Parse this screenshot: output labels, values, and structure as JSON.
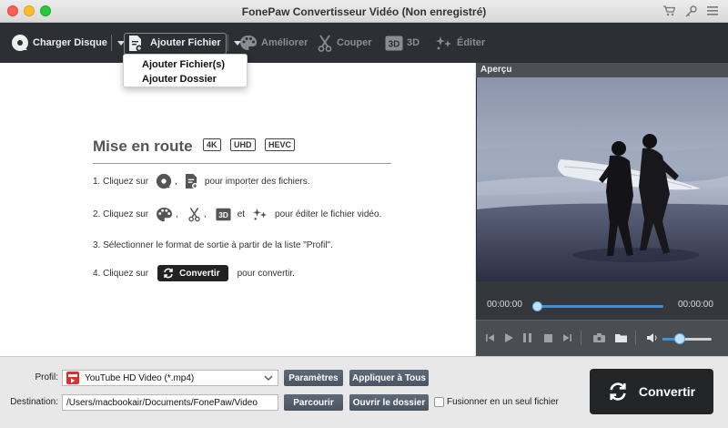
{
  "window": {
    "title": "FonePaw Convertisseur Vidéo (Non enregistré)"
  },
  "toolbar": {
    "load_disc": "Charger Disque",
    "add_file": "Ajouter Fichier",
    "enhance": "Améliorer",
    "cut": "Couper",
    "three_d": "3D",
    "edit": "Éditer"
  },
  "add_menu": {
    "items": [
      "Ajouter Fichier(s)",
      "Ajouter Dossier"
    ]
  },
  "getting_started": {
    "title": "Mise en route",
    "badges": [
      "4K",
      "UHD",
      "HEVC"
    ],
    "step1_a": "1. Cliquez sur",
    "step1_b": ",",
    "step1_c": "pour importer des fichiers.",
    "step2_a": "2. Cliquez sur",
    "step2_b": ",",
    "step2_c": ",",
    "step2_d": "et",
    "step2_e": "pour éditer le fichier vidéo.",
    "step3": "3. Sélectionner le format de sortie à partir de la liste \"Profil\".",
    "step4_a": "4. Cliquez sur",
    "step4_button": "Convertir",
    "step4_b": "pour convertir."
  },
  "preview": {
    "header": "Aperçu",
    "time_start": "00:00:00",
    "time_end": "00:00:00",
    "volume_level": 0.35
  },
  "bottom": {
    "profile_label": "Profil:",
    "profile_value": "YouTube HD Video (*.mp4)",
    "settings_button": "Paramètres",
    "apply_all_button": "Appliquer à Tous",
    "destination_label": "Destination:",
    "destination_value": "/Users/macbookair/Documents/FonePaw/Video",
    "browse_button": "Parcourir",
    "open_folder_button": "Ouvrir le dossier",
    "merge_label": "Fusionner en un seul fichier",
    "convert_button": "Convertir"
  },
  "colors": {
    "accent": "#3d8fd8",
    "toolbar_bg": "#2c2f33",
    "button_bg": "#4a5563"
  }
}
